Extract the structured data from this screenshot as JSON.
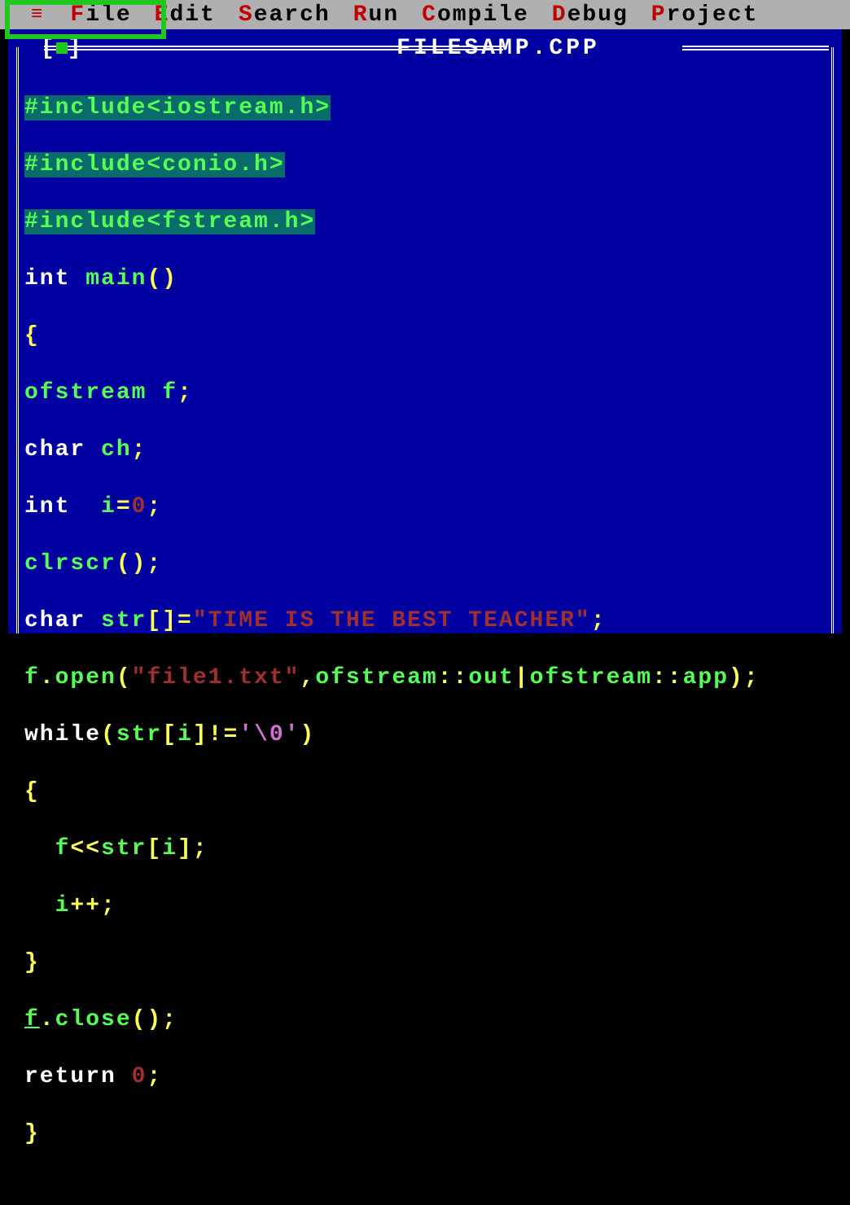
{
  "menu": {
    "hamburger": "≡",
    "items": [
      {
        "hotkey": "F",
        "rest": "ile"
      },
      {
        "hotkey": "E",
        "rest": "dit"
      },
      {
        "hotkey": "S",
        "rest": "earch"
      },
      {
        "hotkey": "R",
        "rest": "un"
      },
      {
        "hotkey": "C",
        "rest": "ompile"
      },
      {
        "hotkey": "D",
        "rest": "ebug"
      },
      {
        "hotkey": "P",
        "rest": "roject"
      }
    ]
  },
  "window": {
    "filename": "FILESAMP.CPP",
    "bracket_open": "[",
    "bracket_close": "]"
  },
  "code": {
    "l1a": "#include<iostream.h>",
    "l2a": "#include<conio.h>",
    "l3a": "#include<fstream.h>",
    "l4a": "int",
    "l4b": " main",
    "l4c": "()",
    "l5a": "{",
    "l6a": "ofstream f",
    "l6b": ";",
    "l7a": "char",
    "l7b": " ch",
    "l7c": ";",
    "l8a": "int",
    "l8b": "  i",
    "l8c": "=",
    "l8d": "0",
    "l8e": ";",
    "l9a": "clrscr",
    "l9b": "();",
    "l10a": "char",
    "l10b": " str",
    "l10c": "[]=",
    "l10d": "\"TIME IS THE BEST TEACHER\"",
    "l10e": ";",
    "l11a": "f",
    "l11b": ".",
    "l11c": "open",
    "l11d": "(",
    "l11e": "\"file1.txt\"",
    "l11f": ",",
    "l11g": "ofstream",
    "l11h": "::",
    "l11i": "out",
    "l11j": "|",
    "l11k": "ofstream",
    "l11l": "::",
    "l11m": "app",
    "l11n": ");",
    "l12a": "while",
    "l12b": "(",
    "l12c": "str",
    "l12d": "[",
    "l12e": "i",
    "l12f": "]!=",
    "l12g": "'\\0'",
    "l12h": ")",
    "l13a": "{",
    "l14a": "  f",
    "l14b": "<<",
    "l14c": "str",
    "l14d": "[",
    "l14e": "i",
    "l14f": "];",
    "l15a": "  i",
    "l15b": "++;",
    "l16a": "}",
    "l17a": "f",
    "l17b": ".",
    "l17c": "close",
    "l17d": "();",
    "l18a": "return",
    "l18b": " ",
    "l18c": "0",
    "l18d": ";",
    "l19a": "}"
  }
}
